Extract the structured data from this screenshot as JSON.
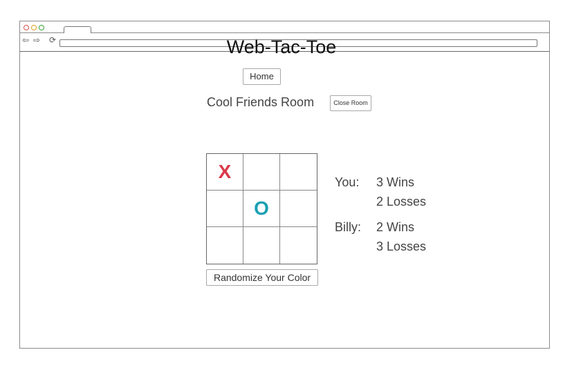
{
  "browser": {
    "address": ""
  },
  "page": {
    "title": "Web-Tac-Toe"
  },
  "nav": {
    "home_label": "Home"
  },
  "room": {
    "name": "Cool Friends Room",
    "close_label": "Close Room"
  },
  "board": {
    "cells": [
      "X",
      "",
      "",
      "",
      "O",
      "",
      "",
      "",
      ""
    ]
  },
  "colors": {
    "x": "#d93a4a",
    "o": "#1aa0b4"
  },
  "randomize_label": "Randomize Your Color",
  "scores": [
    {
      "label": "You:",
      "wins": "3 Wins",
      "losses": "2 Losses"
    },
    {
      "label": "Billy:",
      "wins": "2 Wins",
      "losses": "3 Losses"
    }
  ]
}
